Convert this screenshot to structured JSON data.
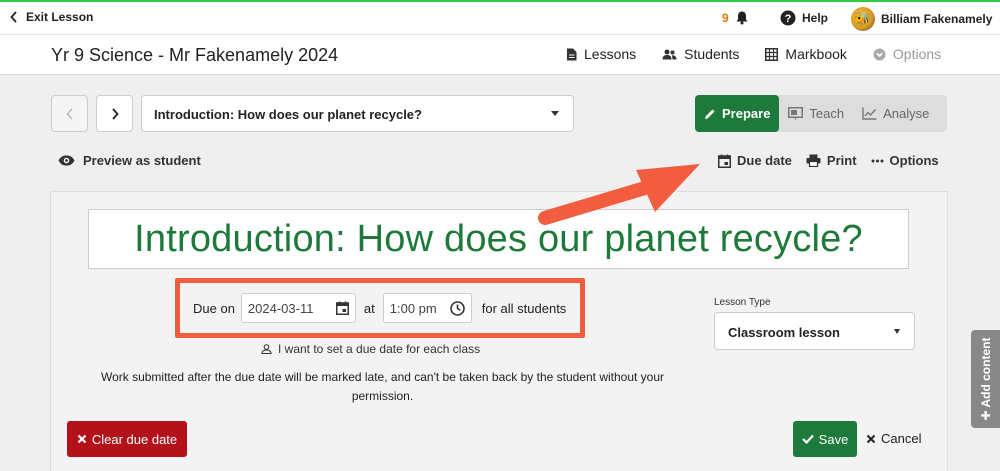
{
  "topbar": {
    "exit_label": "Exit Lesson",
    "notification_count": "9",
    "help_label": "Help",
    "user_name": "Billiam Fakenamely"
  },
  "classbar": {
    "title": "Yr 9 Science - Mr Fakenamely 2024",
    "links": {
      "lessons": "Lessons",
      "students": "Students",
      "markbook": "Markbook",
      "options": "Options"
    }
  },
  "lesson_nav": {
    "selected_lesson": "Introduction: How does our planet recycle?"
  },
  "modes": {
    "prepare": "Prepare",
    "teach": "Teach",
    "analyse": "Analyse",
    "active": "Prepare"
  },
  "toolbar": {
    "preview_label": "Preview as student",
    "due_date_label": "Due date",
    "print_label": "Print",
    "options_label": "Options"
  },
  "lesson": {
    "heading": "Introduction: How does our planet recycle?"
  },
  "due": {
    "due_on_label": "Due on",
    "date_value": "2024-03-11",
    "at_label": "at",
    "time_value": "1:00 pm",
    "all_students_label": "for all students",
    "per_class_label": "I want to set a due date for each class",
    "warning": "Work submitted after the due date will be marked late, and can't be taken back by the student without your permission."
  },
  "lesson_type": {
    "label": "Lesson Type",
    "value": "Classroom lesson"
  },
  "buttons": {
    "clear_due": "Clear due date",
    "save": "Save",
    "cancel": "Cancel"
  },
  "side_tab": {
    "add_content": "Add content"
  },
  "colors": {
    "brand_green": "#1e7a3a",
    "danger_red": "#b3121b",
    "annotation_orange": "#f25c3f",
    "notification_orange": "#e07b00"
  }
}
